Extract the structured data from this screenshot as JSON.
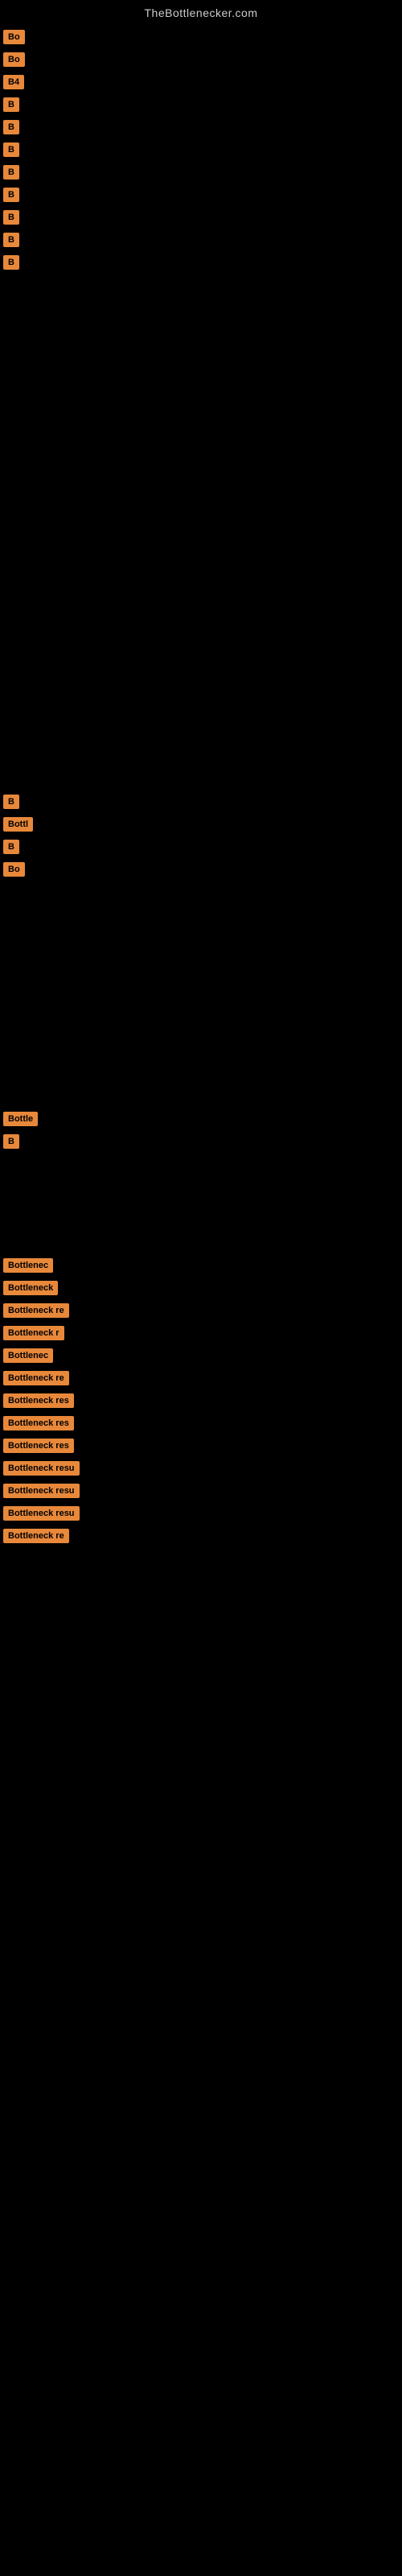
{
  "site": {
    "title": "TheBottlenecker.com"
  },
  "top_badges": [
    {
      "id": "b1",
      "label": "Bo"
    },
    {
      "id": "b2",
      "label": "Bo"
    },
    {
      "id": "b3",
      "label": "B4"
    },
    {
      "id": "b4",
      "label": "B"
    },
    {
      "id": "b5",
      "label": "B"
    },
    {
      "id": "b6",
      "label": "B"
    },
    {
      "id": "b7",
      "label": "B"
    },
    {
      "id": "b8",
      "label": "B"
    },
    {
      "id": "b9",
      "label": "B"
    },
    {
      "id": "b10",
      "label": "B"
    },
    {
      "id": "b11",
      "label": "B"
    }
  ],
  "middle_badges": [
    {
      "id": "m1",
      "label": "B"
    },
    {
      "id": "m2",
      "label": "Bottl"
    },
    {
      "id": "m3",
      "label": "B"
    },
    {
      "id": "m4",
      "label": "Bo"
    }
  ],
  "lower_badges": [
    {
      "id": "l1",
      "label": "Bottle"
    },
    {
      "id": "l2",
      "label": "B"
    }
  ],
  "bottom_badges": [
    {
      "id": "bb1",
      "label": "Bottlenec"
    },
    {
      "id": "bb2",
      "label": "Bottleneck"
    },
    {
      "id": "bb3",
      "label": "Bottleneck re"
    },
    {
      "id": "bb4",
      "label": "Bottleneck r"
    },
    {
      "id": "bb5",
      "label": "Bottlenec"
    },
    {
      "id": "bb6",
      "label": "Bottleneck re"
    },
    {
      "id": "bb7",
      "label": "Bottleneck res"
    },
    {
      "id": "bb8",
      "label": "Bottleneck res"
    },
    {
      "id": "bb9",
      "label": "Bottleneck res"
    },
    {
      "id": "bb10",
      "label": "Bottleneck resu"
    },
    {
      "id": "bb11",
      "label": "Bottleneck resu"
    },
    {
      "id": "bb12",
      "label": "Bottleneck resu"
    },
    {
      "id": "bb13",
      "label": "Bottleneck re"
    }
  ]
}
